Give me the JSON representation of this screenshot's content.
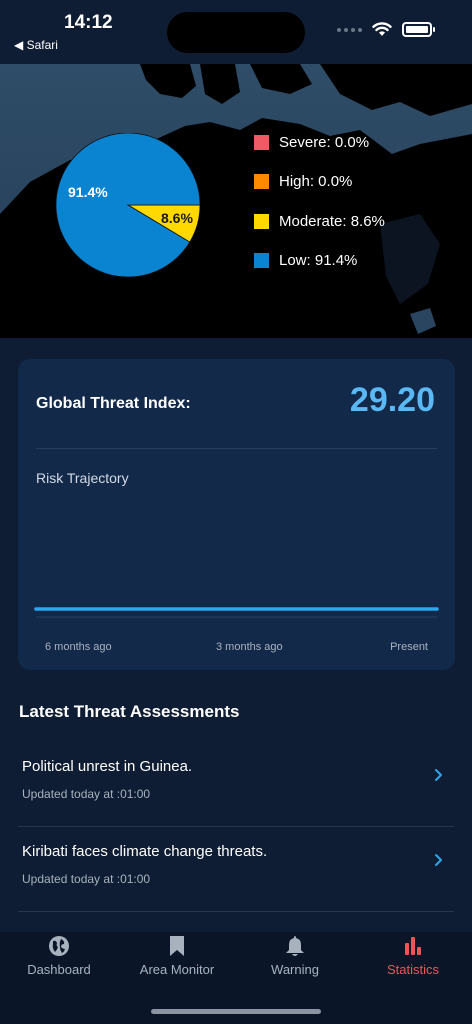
{
  "status_bar": {
    "time": "14:12",
    "back_label": "◀ Safari"
  },
  "chart_data": {
    "type": "pie",
    "slices": [
      {
        "name": "Severe",
        "value": 0.0,
        "color": "#f05a64"
      },
      {
        "name": "High",
        "value": 0.0,
        "color": "#ff8a00"
      },
      {
        "name": "Moderate",
        "value": 8.6,
        "color": "#ffd900"
      },
      {
        "name": "Low",
        "value": 91.4,
        "color": "#0a84d0"
      }
    ],
    "data_labels": {
      "low": "91.4%",
      "moderate": "8.6%"
    },
    "legend": [
      "Severe: 0.0%",
      "High: 0.0%",
      "Moderate: 8.6%",
      "Low: 91.4%"
    ],
    "legend_placement": "right"
  },
  "threat_index": {
    "title": "Global Threat Index:",
    "value": "29.20",
    "trajectory_title": "Risk Trajectory",
    "trajectory": {
      "type": "line",
      "x": [
        "6 months ago",
        "3 months ago",
        "Present"
      ],
      "y": [
        29.2,
        29.2,
        29.2
      ],
      "color": "#2aa8ee"
    }
  },
  "assessments": {
    "title": "Latest Threat Assessments",
    "items": [
      {
        "headline": "Political unrest in Guinea.",
        "updated": "Updated today at :01:00"
      },
      {
        "headline": "Kiribati faces climate change threats.",
        "updated": "Updated today at :01:00"
      }
    ]
  },
  "tabs": [
    {
      "label": "Dashboard",
      "icon": "globe-icon",
      "active": false
    },
    {
      "label": "Area Monitor",
      "icon": "bookmark-icon",
      "active": false
    },
    {
      "label": "Warning",
      "icon": "bell-icon",
      "active": false
    },
    {
      "label": "Statistics",
      "icon": "bar-chart-icon",
      "active": true
    }
  ],
  "colors": {
    "background": "#0e1d33",
    "card": "#13294a",
    "accent": "#5ab8f5",
    "active_tab": "#f0545a"
  }
}
